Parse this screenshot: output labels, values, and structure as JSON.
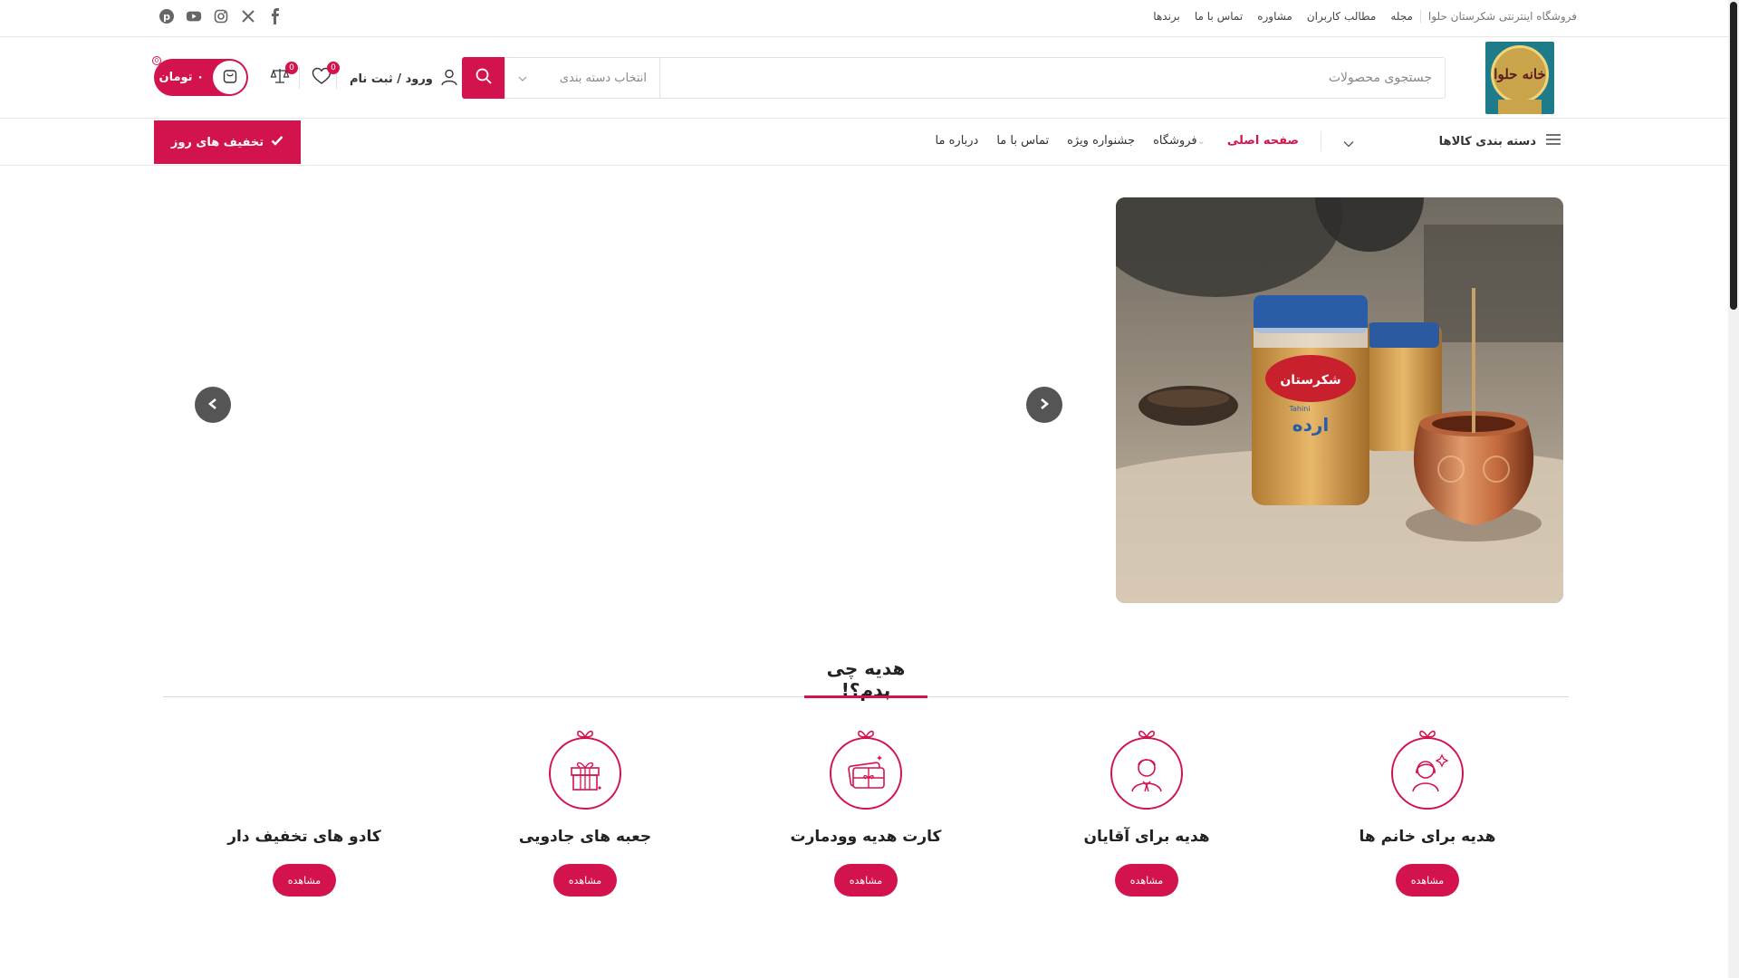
{
  "topbar": {
    "brand_text": "فروشگاه اینترنتی شکرستان حلوا",
    "links": [
      "مجله",
      "مطالب کاربران",
      "مشاوره",
      "تماس با ما",
      "برندها"
    ],
    "social": [
      "facebook-icon",
      "x-icon",
      "instagram-icon",
      "youtube-icon",
      "pinterest-icon"
    ]
  },
  "header": {
    "logo_text": "خانه حلوا",
    "search_placeholder": "جستجوی محصولات",
    "category_select": "انتخاب دسته بندی",
    "login_label": "ورود / ثبت نام",
    "compare_count": "0",
    "wishlist_count": "0",
    "cart_total": "۰ تومان",
    "cart_count": "0"
  },
  "nav": {
    "categories_label": "دسته بندی کالاها",
    "items": [
      "صفحه اصلی",
      "فروشگاه",
      "جشنواره ویژه",
      "تماس با ما",
      "درباره ما"
    ],
    "deals_label": "تخفیف های روز"
  },
  "hero": {
    "jar_brand": "شکرستان",
    "jar_product": "ارده",
    "jar_subtext": "Tahini"
  },
  "gift_section": {
    "title": "هدیه چی بدم؟!",
    "button_label": "مشاهده",
    "items": [
      {
        "title": "هدیه برای خانم ها",
        "icon": "woman-icon"
      },
      {
        "title": "هدیه برای آقایان",
        "icon": "man-icon"
      },
      {
        "title": "کارت هدیه وودمارت",
        "icon": "gift-card-icon"
      },
      {
        "title": "جعبه های جادویی",
        "icon": "gift-box-icon"
      },
      {
        "title": "کادو های تخفیف دار",
        "icon": "discount-gift-icon"
      }
    ]
  },
  "colors": {
    "accent": "#d3134d",
    "logo_bg": "#1d7b8a",
    "logo_gold": "#c9a44a"
  }
}
